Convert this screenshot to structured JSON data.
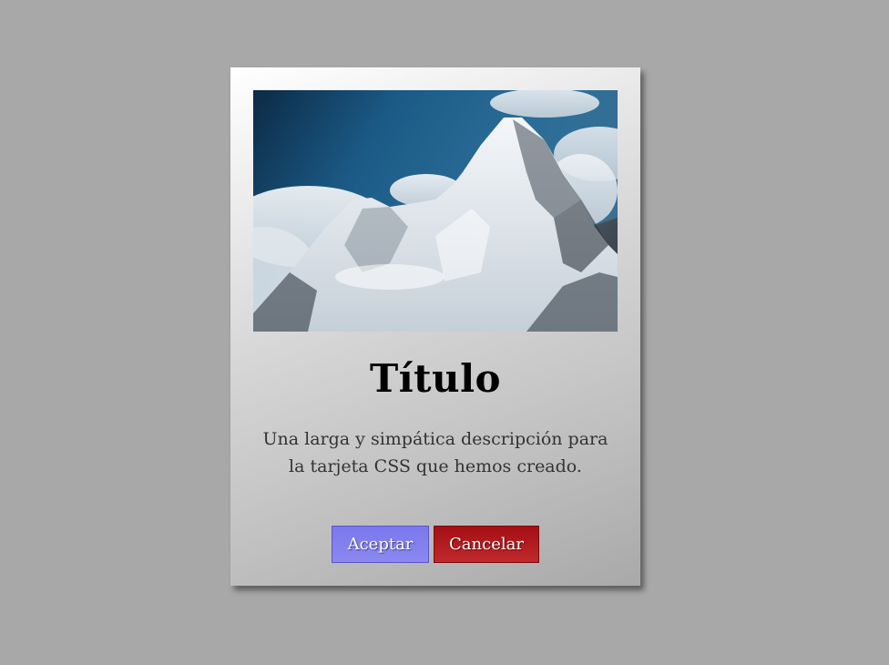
{
  "card": {
    "image_alt": "Mountain peak with snow and clouds",
    "title": "Título",
    "description": "Una larga y simpática descripción para la tarjeta CSS que hemos creado.",
    "buttons": {
      "accept_label": "Aceptar",
      "cancel_label": "Cancelar"
    }
  },
  "colors": {
    "background": "#a8a8a8",
    "accept": "#7b78ee",
    "cancel": "#b11c20"
  }
}
